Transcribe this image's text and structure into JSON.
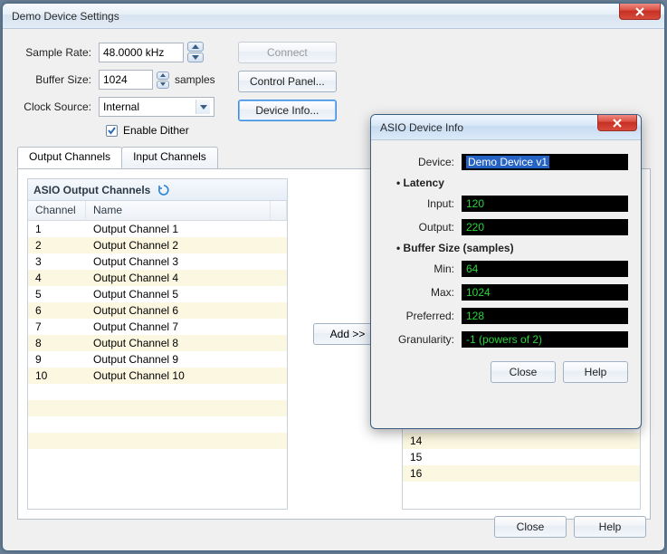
{
  "main": {
    "title": "Demo Device Settings",
    "labels": {
      "sampleRate": "Sample Rate:",
      "bufferSize": "Buffer Size:",
      "clockSource": "Clock Source:",
      "samplesUnit": "samples",
      "enableDither": "Enable Dither"
    },
    "values": {
      "sampleRate": "48.0000 kHz",
      "bufferSize": "1024",
      "clockSource": "Internal",
      "enableDitherChecked": true
    },
    "buttons": {
      "connect": "Connect",
      "controlPanel": "Control Panel...",
      "deviceInfo": "Device Info...",
      "add": "Add  >>",
      "close": "Close",
      "help": "Help"
    },
    "tabs": {
      "output": "Output Channels",
      "input": "Input Channels"
    },
    "leftList": {
      "title": "ASIO Output Channels",
      "colChannel": "Channel",
      "colName": "Name",
      "rows": [
        {
          "ch": "1",
          "nm": "Output Channel 1"
        },
        {
          "ch": "2",
          "nm": "Output Channel 2"
        },
        {
          "ch": "3",
          "nm": "Output Channel 3"
        },
        {
          "ch": "4",
          "nm": "Output Channel 4"
        },
        {
          "ch": "5",
          "nm": "Output Channel 5"
        },
        {
          "ch": "6",
          "nm": "Output Channel 6"
        },
        {
          "ch": "7",
          "nm": "Output Channel 7"
        },
        {
          "ch": "8",
          "nm": "Output Channel 8"
        },
        {
          "ch": "9",
          "nm": "Output Channel 9"
        },
        {
          "ch": "10",
          "nm": "Output Channel 10"
        }
      ],
      "emptyRows": 5
    },
    "rightList": {
      "visibleTail": [
        "14",
        "15",
        "16"
      ],
      "trailingEmpty": 1
    }
  },
  "dialog": {
    "title": "ASIO Device Info",
    "labels": {
      "device": "Device:",
      "latency": "Latency",
      "input": "Input:",
      "output": "Output:",
      "bufferSize": "Buffer Size (samples)",
      "min": "Min:",
      "max": "Max:",
      "preferred": "Preferred:",
      "granularity": "Granularity:"
    },
    "values": {
      "device": "Demo Device v1",
      "input": "120",
      "output": "220",
      "min": "64",
      "max": "1024",
      "preferred": "128",
      "granularity": "-1 (powers of 2)"
    },
    "buttons": {
      "close": "Close",
      "help": "Help"
    }
  }
}
